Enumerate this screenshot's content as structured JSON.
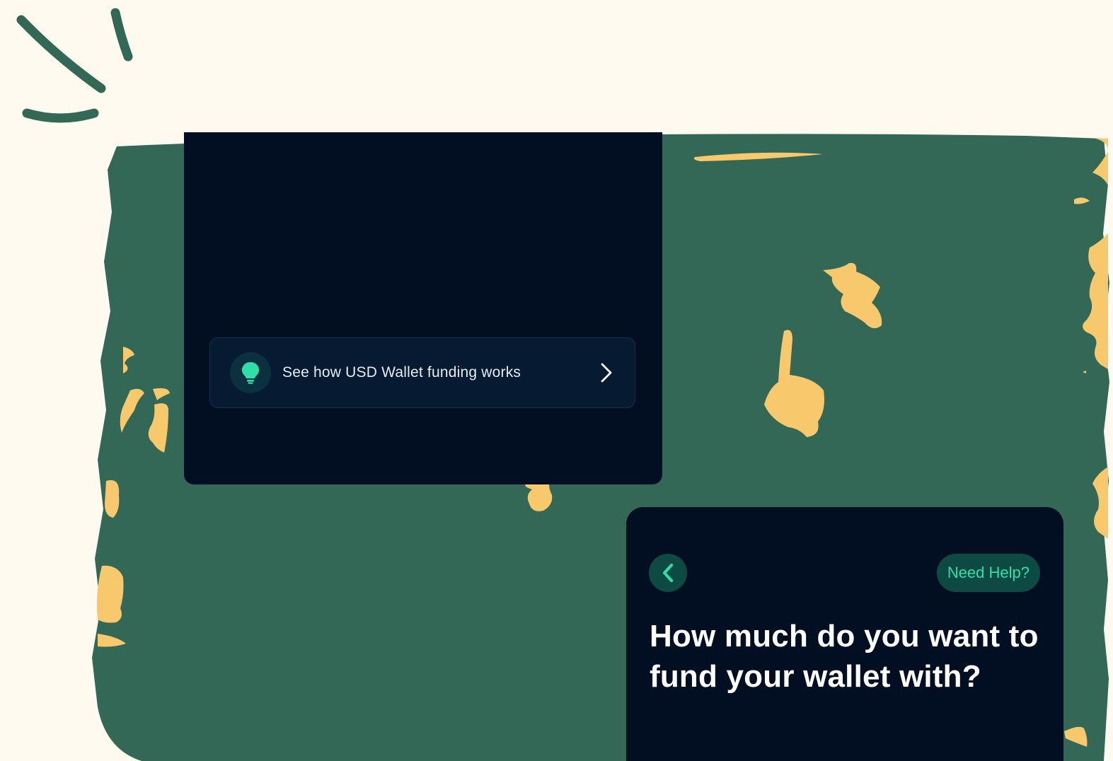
{
  "colors": {
    "page_background": "#fefaf0",
    "brush_green": "#336857",
    "splash_yellow": "#f7c96c",
    "card_navy": "#020f22",
    "accent_mint": "#2fe0a6",
    "button_teal": "#0e4a44"
  },
  "tip_card": {
    "icon": "lightbulb-icon",
    "label": "See how USD Wallet funding works",
    "chevron_icon": "chevron-right-icon"
  },
  "fund_card": {
    "back_icon": "chevron-left-icon",
    "help_label": "Need Help?",
    "question": "How much do you want to fund your wallet with?"
  }
}
